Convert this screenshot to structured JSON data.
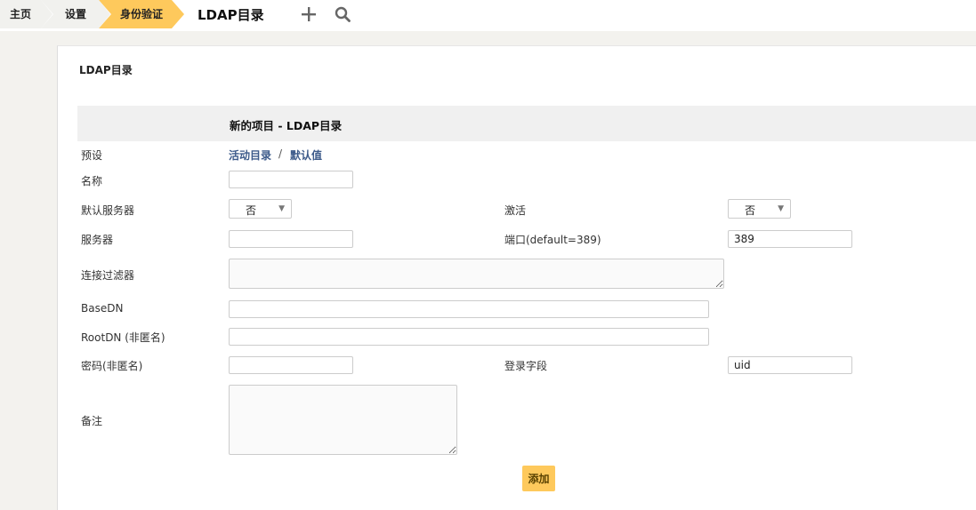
{
  "breadcrumb": {
    "home": "主页",
    "settings": "设置",
    "auth": "身份验证",
    "current": "LDAP目录"
  },
  "toolbar_icons": [
    "add-icon",
    "search-icon"
  ],
  "panel": {
    "title": "LDAP目录",
    "form_header": "新的项目 - LDAP目录"
  },
  "form": {
    "preset_label": "预设",
    "preset_links": [
      "活动目录",
      "默认值"
    ],
    "preset_separator": "/",
    "name_label": "名称",
    "name_value": "",
    "default_server_label": "默认服务器",
    "default_server_value": "否",
    "active_label": "激活",
    "active_value": "否",
    "server_label": "服务器",
    "server_value": "",
    "port_label": "端口(default=389)",
    "port_value": "389",
    "connection_filter_label": "连接过滤器",
    "basedn_label": "BaseDN",
    "basedn_value": "",
    "rootdn_label": "RootDN (非匿名)",
    "rootdn_value": "",
    "password_label": "密码(非匿名)",
    "password_value": "",
    "login_field_label": "登录字段",
    "login_field_value": "uid",
    "comment_label": "备注",
    "submit_label": "添加"
  },
  "colors": {
    "accent": "#fec95c",
    "link": "#3c5a8a",
    "page_bg": "#f3f2ee"
  }
}
